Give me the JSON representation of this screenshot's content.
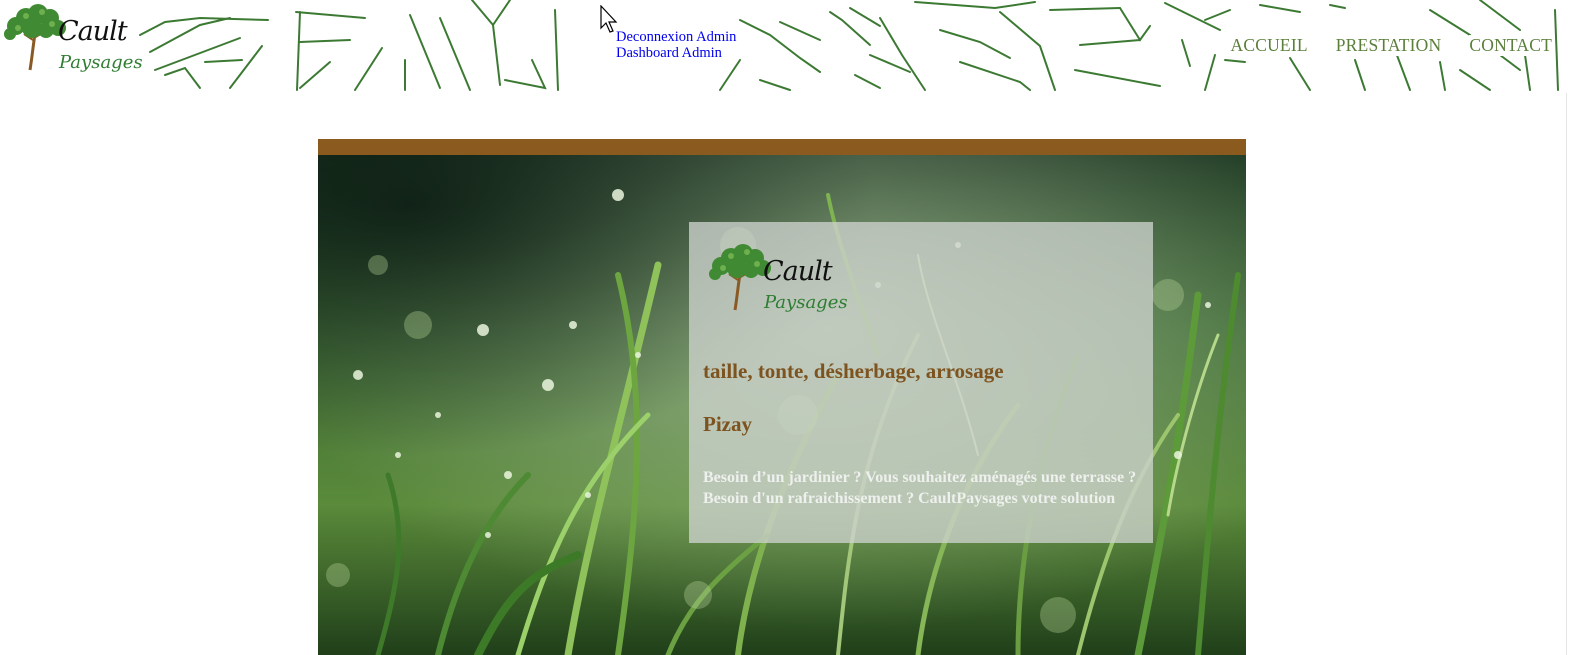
{
  "header": {
    "logo": {
      "name": "Cault",
      "tagline": "Paysages"
    },
    "admin": {
      "logout_label": "Deconnexion Admin",
      "dashboard_label": "Dashboard Admin"
    },
    "nav": {
      "home_label": "ACCUEIL",
      "services_label": "PRESTATION",
      "contact_label": "CONTACT"
    }
  },
  "hero": {
    "card": {
      "logo": {
        "name": "Cault",
        "tagline": "Paysages"
      },
      "title": "taille, tonte, désherbage, arrosage",
      "city": "Pizay",
      "description": "Besoin d’un jardinier ? Vous souhaitez aménagés une terrasse ? Besoin d'un rafraichissement ? CaultPaysages votre solution"
    }
  },
  "colors": {
    "brand_green": "#3f7d2f",
    "brand_brown": "#8b5a1e",
    "link_blue": "#0000ee"
  },
  "icons": {
    "cursor": "mouse-pointer-icon",
    "logo": "tree-logo-icon"
  }
}
